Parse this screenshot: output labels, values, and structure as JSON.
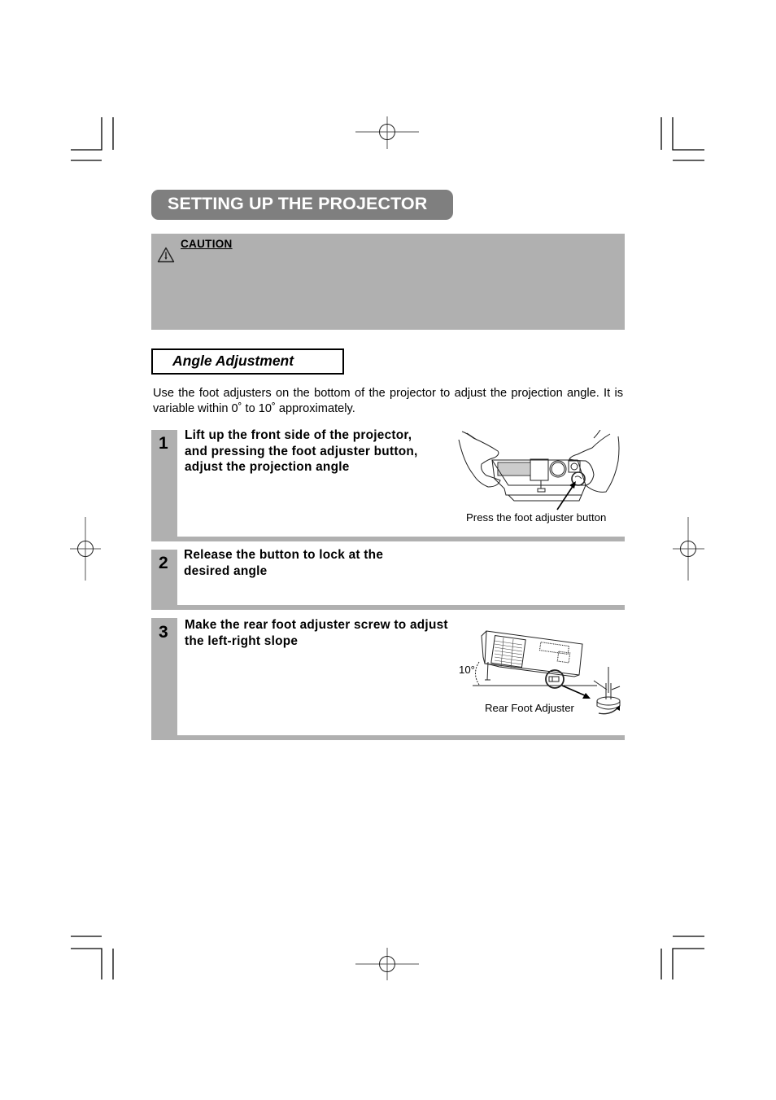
{
  "page": {
    "header_title": "SETTING UP THE PROJECTOR",
    "caution": {
      "icon": "warning-triangle-icon",
      "label": "CAUTION"
    },
    "section": {
      "title": "Angle Adjustment",
      "intro": "Use the foot adjusters on the bottom of the projector to adjust the projection angle. It is variable within 0˚ to 10˚ approximately."
    },
    "steps": [
      {
        "number": "1",
        "text": "Lift up the front side of the projector, and pressing the foot adjuster button, adjust the projection angle",
        "illustration": "hands-lifting-projector-illustration",
        "caption": "Press the foot adjuster button"
      },
      {
        "number": "2",
        "text": "Release the button to lock at the desired angle"
      },
      {
        "number": "3",
        "text": "Make the rear foot adjuster screw to adjust the left-right slope",
        "illustration": "projector-tilt-rear-foot-illustration",
        "angle_label": "10°",
        "caption": "Rear Foot Adjuster"
      }
    ],
    "colors": {
      "title_pill": "#7f7f7f",
      "panel_gray": "#b0b0b0"
    }
  }
}
